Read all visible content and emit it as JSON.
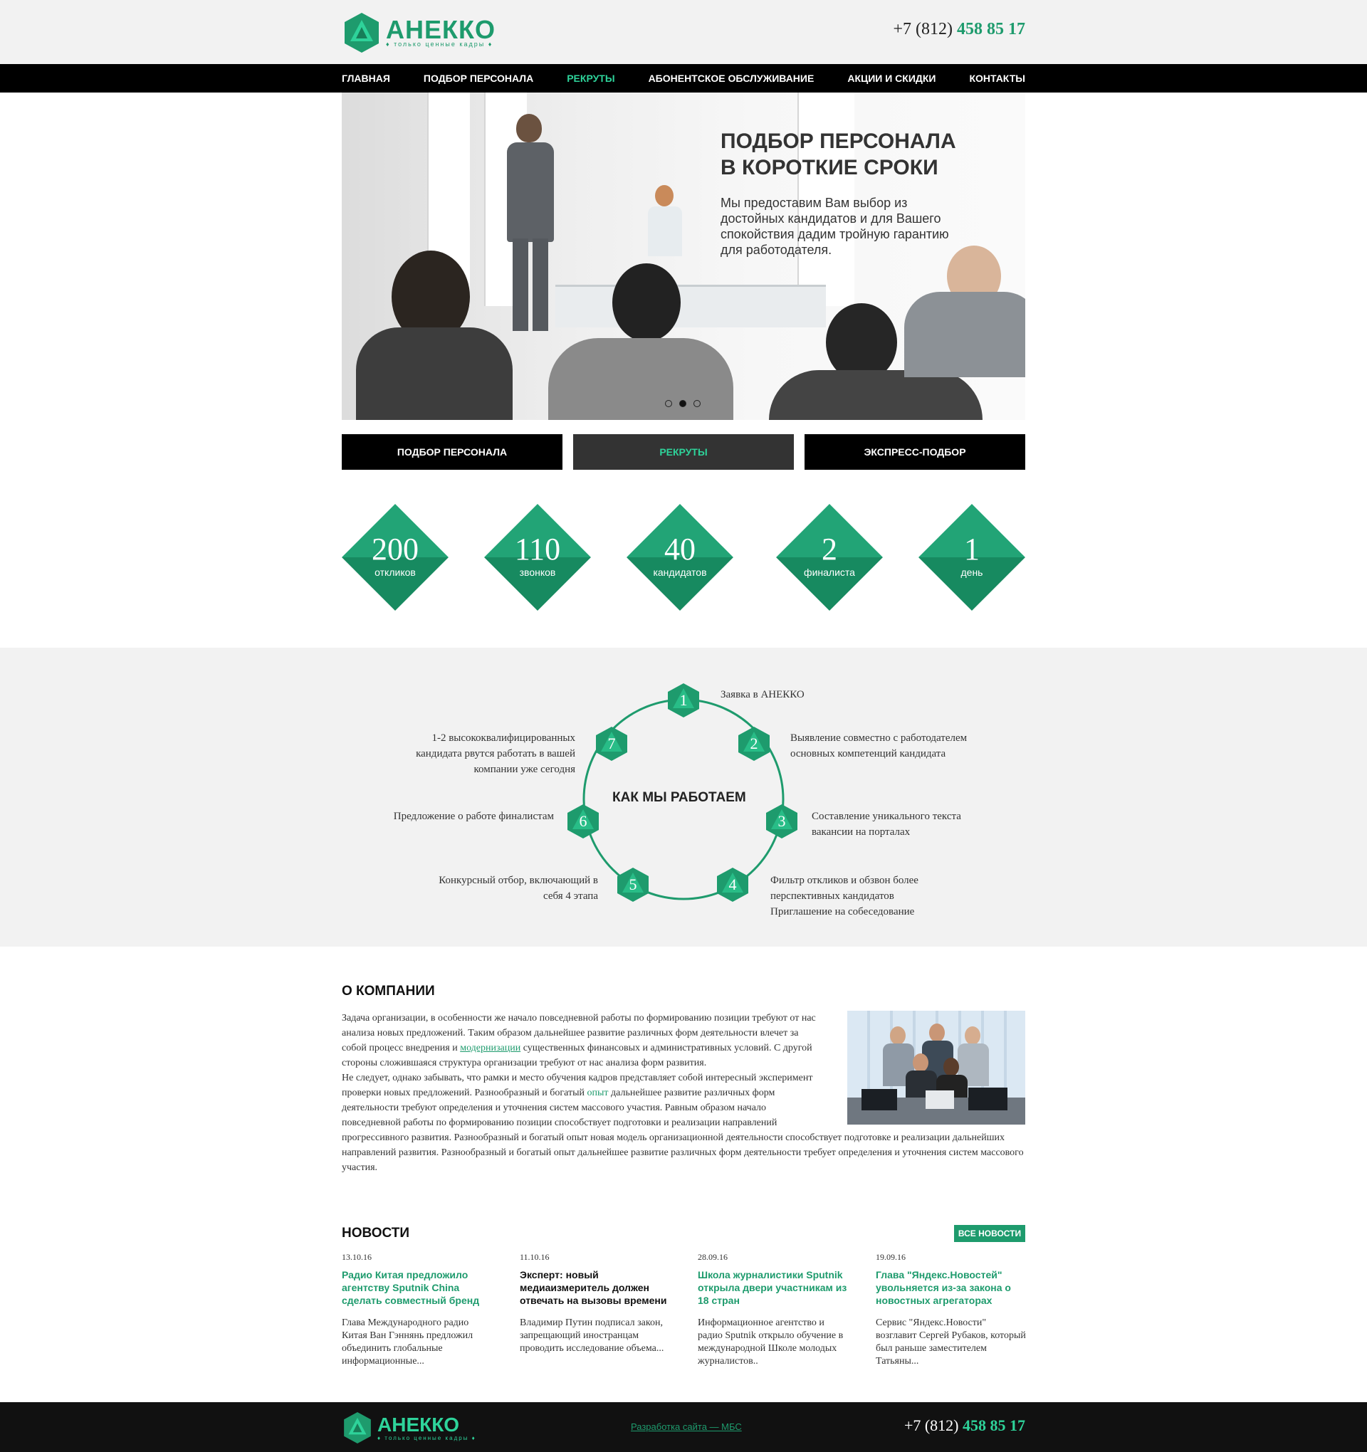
{
  "header": {
    "logo_name": "АНЕККО",
    "logo_tagline": "♦ только ценные кадры ♦",
    "phone_prefix": "+7 (812)",
    "phone_number": "458 85 17"
  },
  "nav": {
    "items": [
      "ГЛАВНАЯ",
      "ПОДБОР ПЕРСОНАЛА",
      "РЕКРУТЫ",
      "АБОНЕНТСКОЕ ОБСЛУЖИВАНИЕ",
      "АКЦИИ И СКИДКИ",
      "КОНТАКТЫ"
    ],
    "active": "РЕКРУТЫ"
  },
  "hero": {
    "title_line1": "ПОДБОР ПЕРСОНАЛА",
    "title_line2": "В КОРОТКИЕ СРОКИ",
    "text": "Мы предоставим Вам выбор из достойных кандидатов и для Вашего спокойствия дадим тройную гарантию для работодателя.",
    "slides": 3,
    "active_slide": 2
  },
  "tabs": [
    "ПОДБОР ПЕРСОНАЛА",
    "РЕКРУТЫ",
    "ЭКСПРЕСС-ПОДБОР"
  ],
  "stats": [
    {
      "value": "200",
      "label": "откликов"
    },
    {
      "value": "110",
      "label": "звонков"
    },
    {
      "value": "40",
      "label": "кандидатов"
    },
    {
      "value": "2",
      "label": "финалиста"
    },
    {
      "value": "1",
      "label": "день"
    }
  ],
  "process": {
    "title": "КАК МЫ РАБОТАЕМ",
    "steps": [
      {
        "n": "1",
        "text": "Заявка в АНЕККО"
      },
      {
        "n": "2",
        "text": "Выявление совместно с работодателем основных компетенций кандидата"
      },
      {
        "n": "3",
        "text": "Составление уникального текста вакансии на порталах"
      },
      {
        "n": "4",
        "text": "Фильтр откликов и обзвон более перспективных кандидатов Приглашение на собеседование"
      },
      {
        "n": "5",
        "text": "Конкурсный отбор, включающий в себя 4 этапа"
      },
      {
        "n": "6",
        "text": "Предложение о работе финалистам"
      },
      {
        "n": "7",
        "text": "1-2 высококвалифицированных кандидата рвутся работать в вашей компании уже сегодня"
      }
    ]
  },
  "about": {
    "title": "О КОМПАНИИ",
    "p1_a": "Задача организации, в особенности же начало повседневной работы по формированию позиции требуют от нас анализа новых предложений. Таким образом дальнейшее развитие различных форм деятельности влечет за собой процесс внедрения и ",
    "p1_link": "модернизации",
    "p1_b": " существенных финансовых и административных условий. С другой стороны сложившаяся структура организации требуют от нас анализа форм развития.",
    "p2_a": "Не следует, однако забывать, что рамки и место обучения кадров представляет собой интересный эксперимент проверки новых предложений. Разнообразный и богатый ",
    "p2_link": "опыт",
    "p2_b": " дальнейшее развитие различных форм деятельности требуют определения и уточнения систем массового участия. Равным образом начало повседневной работы по формированию позиции способствует подготовки и реализации направлений прогрессивного развития. Разнообразный и богатый опыт новая модель организационной деятельности способствует подготовке и реализации дальнейших направлений развития. Разнообразный и богатый опыт дальнейшее развитие различных форм деятельности требует определения и уточнения систем массового участия."
  },
  "news": {
    "title": "НОВОСТИ",
    "all_label": "ВСЕ НОВОСТИ",
    "items": [
      {
        "date": "13.10.16",
        "title": "Радио Китая предложило агентству Sputnik China сделать совместный бренд",
        "text": "Глава Международного радио Китая Ван Гэннянь предложил объединить глобальные информационные..."
      },
      {
        "date": "11.10.16",
        "title": "Эксперт: новый медиаизмеритель должен отвечать на вызовы времени",
        "text": "Владимир Путин подписал закон, запрещающий иностранцам проводить исследование объема..."
      },
      {
        "date": "28.09.16",
        "title": "Школа журналистики Sputnik открыла двери участникам из 18 стран",
        "text": "Информационное агентство и радио Sputnik открыло обучение в международной Школе молодых журналистов.."
      },
      {
        "date": "19.09.16",
        "title": "Глава \"Яндекс.Новостей\" увольняется из-за закона о новостных агрегаторах",
        "text": "Сервис \"Яндекс.Новости\" возглавит Сергей Рубаков, который был раньше заместителем Татьяны..."
      }
    ]
  },
  "footer": {
    "logo_name": "АНЕККО",
    "logo_tagline": "♦ только ценные кадры ♦",
    "dev_link": "Разработка сайта — МБС",
    "phone_prefix": "+7 (812)",
    "phone_number": "458 85 17"
  },
  "colors": {
    "accent": "#1e9b6d",
    "accent_light": "#2ed39a",
    "nav_bg": "#000000",
    "section_bg": "#f2f2f2"
  }
}
